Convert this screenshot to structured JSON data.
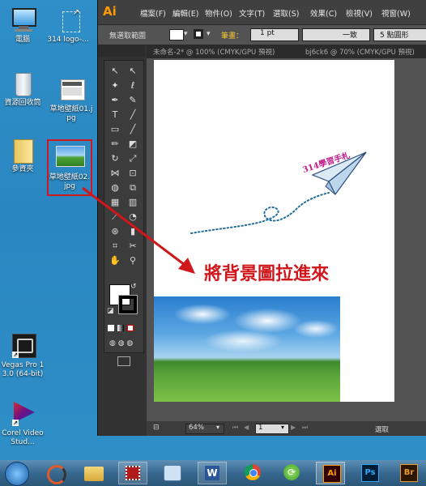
{
  "desktop": {
    "icons": [
      {
        "label": "電腦"
      },
      {
        "label": "314 logo-..."
      },
      {
        "label": "資源回收筒"
      },
      {
        "label": "草地壁紙01.jpg"
      },
      {
        "label": "參資夾"
      },
      {
        "label": "草地壁紙02.jpg"
      },
      {
        "label": "Vegas Pro 13.0 (64-bit)"
      },
      {
        "label": "Corel VideoStud..."
      }
    ],
    "annotation": "將背景圖拉進來",
    "annotation_color": "#d0171c"
  },
  "illustrator": {
    "logo": "Ai",
    "menu": [
      "檔案(F)",
      "編輯(E)",
      "物件(O)",
      "文字(T)",
      "選取(S)",
      "效果(C)",
      "檢視(V)",
      "視窗(W)"
    ],
    "control": {
      "selection": "無選取範圍",
      "stroke_label": "筆畫：",
      "stroke_value": "1 pt",
      "profile": "一致",
      "brush": "5 點圓形"
    },
    "tabs": [
      "未命名-2* @ 100% (CMYK/GPU 預視)",
      "bj6ck6 @ 70% (CMYK/GPU 預視)"
    ],
    "zoom": "64%",
    "page": "1",
    "status": "選取",
    "artboard_logo": "314學習手札"
  },
  "taskbar": {
    "apps": [
      "start",
      "slicer-app",
      "file-explorer",
      "film-app",
      "device-app",
      "word",
      "chrome",
      "refresh-app",
      "illustrator",
      "photoshop",
      "bridge"
    ]
  }
}
